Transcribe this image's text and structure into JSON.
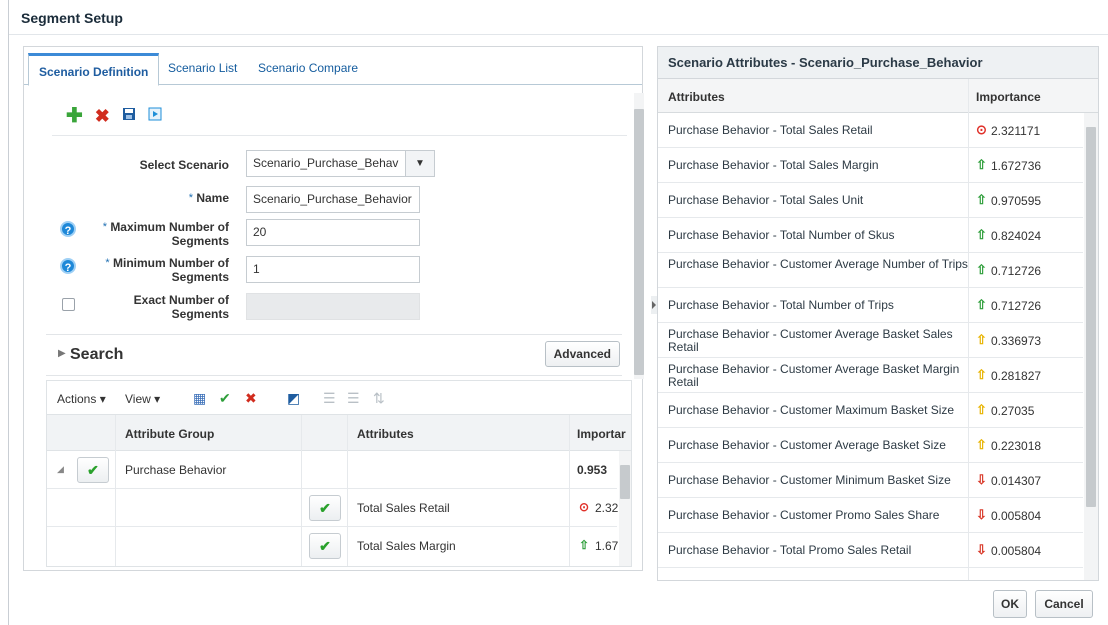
{
  "window": {
    "title": "Segment Setup"
  },
  "tabs": [
    {
      "label": "Scenario Definition"
    },
    {
      "label": "Scenario List"
    },
    {
      "label": "Scenario Compare"
    }
  ],
  "toolbar": {
    "icons": [
      "add-icon",
      "delete-icon",
      "save-icon",
      "run-icon"
    ],
    "colors": {
      "add": "#3aa53a",
      "delete": "#d12c1e",
      "save": "#1f5da0",
      "run": "#1f8fd8"
    }
  },
  "form": {
    "select_scenario_label": "Select Scenario",
    "select_scenario_value": "Scenario_Purchase_Behav",
    "name_label": "Name",
    "name_value": "Scenario_Purchase_Behavior",
    "max_segments_label_1": "Maximum Number of",
    "max_segments_label_2": "Segments",
    "max_segments_value": "20",
    "min_segments_label_1": "Minimum Number of",
    "min_segments_label_2": "Segments",
    "min_segments_value": "1",
    "exact_segments_label_1": "Exact Number of",
    "exact_segments_label_2": "Segments",
    "required_mark": "*",
    "help_glyph": "?"
  },
  "search": {
    "label": "Search",
    "advanced_label": "Advanced"
  },
  "attr_table": {
    "actions_menu": "Actions",
    "view_menu": "View",
    "columns": [
      "Attribute Group",
      "Attributes",
      "Importar"
    ],
    "rows": [
      {
        "group": "Purchase Behavior",
        "attribute": "",
        "importance": "0.953"
      },
      {
        "group": "",
        "attribute": "Total Sales Retail",
        "importance": "2.32"
      },
      {
        "group": "",
        "attribute": "Total Sales Margin",
        "importance": "1.67"
      }
    ]
  },
  "scenario_attributes": {
    "title": "Scenario Attributes - Scenario_Purchase_Behavior",
    "columns": [
      "Attributes",
      "Importance"
    ],
    "rows": [
      {
        "attribute": "Purchase Behavior - Total Sales Retail",
        "importance": "2.321171",
        "trend": "target"
      },
      {
        "attribute": "Purchase Behavior - Total Sales Margin",
        "importance": "1.672736",
        "trend": "up-green"
      },
      {
        "attribute": "Purchase Behavior - Total Sales Unit",
        "importance": "0.970595",
        "trend": "up-green"
      },
      {
        "attribute": "Purchase Behavior - Total Number of Skus",
        "importance": "0.824024",
        "trend": "up-green"
      },
      {
        "attribute": "Purchase Behavior - Customer Average Number of Trips",
        "importance": "0.712726",
        "trend": "up-green"
      },
      {
        "attribute": "Purchase Behavior - Total Number of Trips",
        "importance": "0.712726",
        "trend": "up-green"
      },
      {
        "attribute": "Purchase Behavior - Customer Average Basket Sales Retail",
        "importance": "0.336973",
        "trend": "up-yellow"
      },
      {
        "attribute": "Purchase Behavior - Customer Average Basket Margin Retail",
        "importance": "0.281827",
        "trend": "up-yellow"
      },
      {
        "attribute": "Purchase Behavior - Customer Maximum Basket Size",
        "importance": "0.27035",
        "trend": "up-yellow"
      },
      {
        "attribute": "Purchase Behavior - Customer Average Basket Size",
        "importance": "0.223018",
        "trend": "up-yellow"
      },
      {
        "attribute": "Purchase Behavior - Customer Minimum Basket Size",
        "importance": "0.014307",
        "trend": "down-red"
      },
      {
        "attribute": "Purchase Behavior - Customer Promo Sales Share",
        "importance": "0.005804",
        "trend": "down-red"
      },
      {
        "attribute": "Purchase Behavior - Total Promo Sales Retail",
        "importance": "0.005804",
        "trend": "down-red"
      }
    ]
  },
  "buttons": {
    "ok": "OK",
    "cancel": "Cancel"
  },
  "trend_colors": {
    "target": "#e0312a",
    "up-green": "#2e9e3a",
    "up-yellow": "#e8b400",
    "down-red": "#d93a2a"
  }
}
